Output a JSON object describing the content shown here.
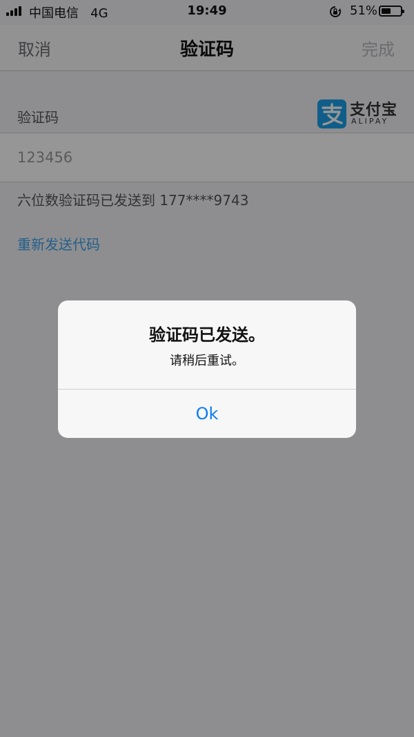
{
  "status_bar": {
    "carrier": "中国电信",
    "network": "4G",
    "time": "19:49",
    "battery_percent": "51%",
    "battery_level": 0.51,
    "icons": [
      "signal-icon",
      "lock-rotation-icon",
      "battery-icon"
    ]
  },
  "nav": {
    "cancel_label": "取消",
    "title": "验证码",
    "done_label": "完成"
  },
  "form": {
    "section_label": "验证码",
    "code_value": "123456",
    "sent_notice": "六位数验证码已发送到 177****9743",
    "resend_label": "重新发送代码"
  },
  "logo": {
    "cn": "支付宝",
    "en": "ALIPAY",
    "color": "#1b9ee8"
  },
  "alert": {
    "title": "验证码已发送。",
    "message": "请稍后重试。",
    "button_label": "Ok"
  },
  "colors": {
    "link": "#3ea1e6",
    "alert_button": "#0a7cf5"
  }
}
